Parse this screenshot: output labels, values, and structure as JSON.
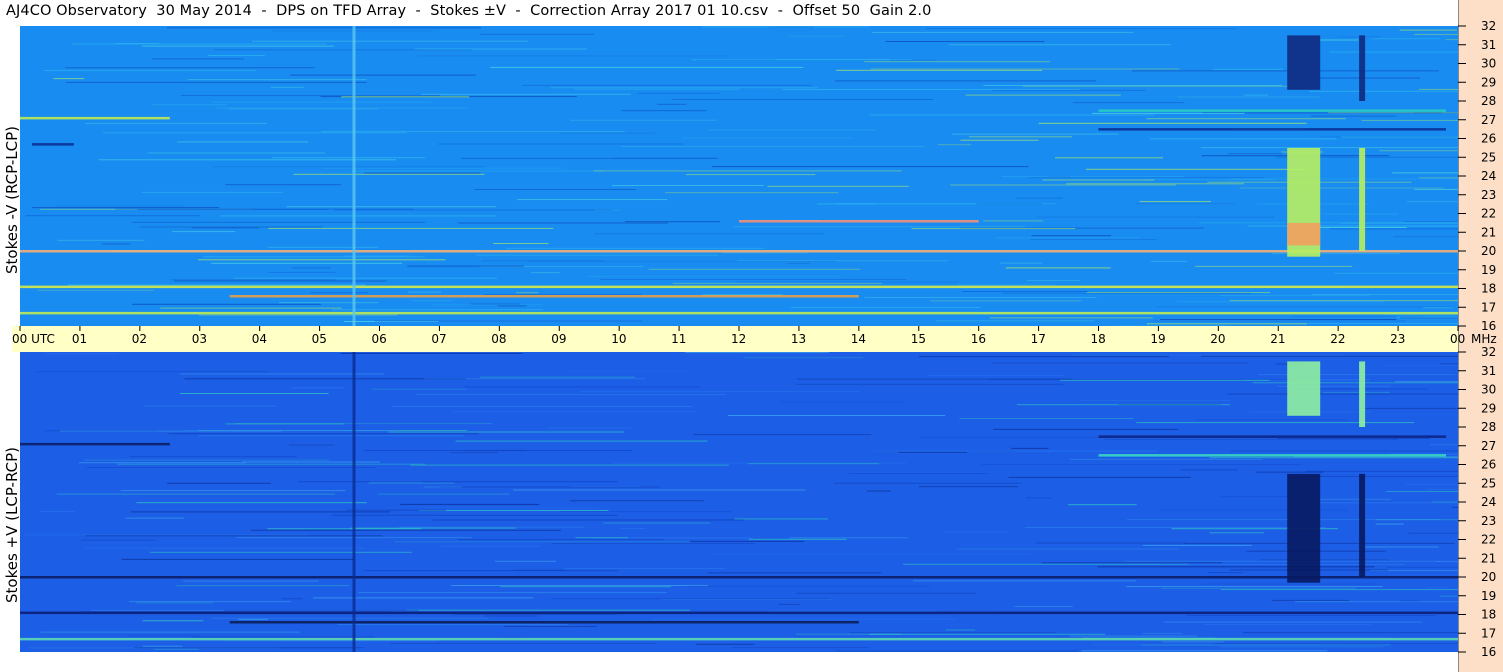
{
  "title": "AJ4CO Observatory  30 May 2014  -  DPS on TFD Array  -  Stokes ±V  -  Correction Array 2017 01 10.csv  -  Offset 50  Gain 2.0",
  "colors": {
    "top_background": "#188cf0",
    "bottom_background": "#1c5ee6",
    "timebar": "#ffffc6",
    "freq_strip": "#fcdfc6"
  },
  "chart_data": [
    {
      "type": "heatmap",
      "ylabel": "Stokes -V (RCP-LCP)",
      "y_unit": "MHz",
      "ylim": [
        16,
        32
      ],
      "y_ticks": [
        "16",
        "17",
        "18",
        "19",
        "20",
        "21",
        "22",
        "23",
        "24",
        "25",
        "26",
        "27",
        "28",
        "29",
        "30",
        "31",
        "32"
      ],
      "x_ticks": [
        "00 UTC",
        "01",
        "02",
        "03",
        "04",
        "05",
        "06",
        "07",
        "08",
        "09",
        "10",
        "11",
        "12",
        "13",
        "14",
        "15",
        "16",
        "17",
        "18",
        "19",
        "20",
        "21",
        "22",
        "23",
        "00"
      ],
      "xlim_hours": [
        0,
        24
      ],
      "features": [
        {
          "kind": "band",
          "freq": 27.1,
          "t_start": 0.0,
          "t_end": 2.5,
          "color": "#c8f04a"
        },
        {
          "kind": "band",
          "freq": 20.0,
          "t_start": 0.0,
          "t_end": 24.0,
          "color": "#ffb070"
        },
        {
          "kind": "band",
          "freq": 18.1,
          "t_start": 0.0,
          "t_end": 24.0,
          "color": "#e0f040"
        },
        {
          "kind": "band",
          "freq": 17.6,
          "t_start": 3.5,
          "t_end": 14.0,
          "color": "#f0a040"
        },
        {
          "kind": "band",
          "freq": 21.6,
          "t_start": 12.0,
          "t_end": 16.0,
          "color": "#ff9070"
        },
        {
          "kind": "band",
          "freq": 16.7,
          "t_start": 0.0,
          "t_end": 24.0,
          "color": "#c8f04a"
        },
        {
          "kind": "band",
          "freq": 26.5,
          "t_start": 18.0,
          "t_end": 23.8,
          "color": "#0a2a90"
        },
        {
          "kind": "band",
          "freq": 27.5,
          "t_start": 18.0,
          "t_end": 23.8,
          "color": "#2acfc0"
        },
        {
          "kind": "band",
          "freq": 25.7,
          "t_start": 0.2,
          "t_end": 0.9,
          "color": "#0a2a90"
        },
        {
          "kind": "vline",
          "t": 5.55,
          "f_start": 16.0,
          "f_end": 32.0,
          "color": "#5cc8f0"
        },
        {
          "kind": "block",
          "t_start": 21.15,
          "t_end": 21.7,
          "f_start": 28.6,
          "f_end": 31.5,
          "color": "#102a80"
        },
        {
          "kind": "block",
          "t_start": 21.15,
          "t_end": 21.7,
          "f_start": 19.7,
          "f_end": 25.5,
          "color": "#b8f060"
        },
        {
          "kind": "block",
          "t_start": 21.15,
          "t_end": 21.7,
          "f_start": 20.3,
          "f_end": 21.5,
          "color": "#f0a060"
        },
        {
          "kind": "block",
          "t_start": 22.35,
          "t_end": 22.45,
          "f_start": 28.0,
          "f_end": 31.5,
          "color": "#102a80"
        },
        {
          "kind": "block",
          "t_start": 22.35,
          "t_end": 22.45,
          "f_start": 20.0,
          "f_end": 25.5,
          "color": "#b8f060"
        }
      ]
    },
    {
      "type": "heatmap",
      "ylabel": "Stokes +V (LCP-RCP)",
      "y_unit": "MHz",
      "ylim": [
        16,
        32
      ],
      "y_ticks": [
        "16",
        "17",
        "18",
        "19",
        "20",
        "21",
        "22",
        "23",
        "24",
        "25",
        "26",
        "27",
        "28",
        "29",
        "30",
        "31",
        "32"
      ],
      "x_ticks": [
        "00 UTC",
        "01",
        "02",
        "03",
        "04",
        "05",
        "06",
        "07",
        "08",
        "09",
        "10",
        "11",
        "12",
        "13",
        "14",
        "15",
        "16",
        "17",
        "18",
        "19",
        "20",
        "21",
        "22",
        "23",
        "00"
      ],
      "xlim_hours": [
        0,
        24
      ],
      "features": [
        {
          "kind": "band",
          "freq": 27.1,
          "t_start": 0.0,
          "t_end": 2.5,
          "color": "#0a1a60"
        },
        {
          "kind": "band",
          "freq": 20.0,
          "t_start": 0.0,
          "t_end": 24.0,
          "color": "#0a1a60"
        },
        {
          "kind": "band",
          "freq": 18.1,
          "t_start": 0.0,
          "t_end": 24.0,
          "color": "#0a1a70"
        },
        {
          "kind": "band",
          "freq": 17.6,
          "t_start": 3.5,
          "t_end": 14.0,
          "color": "#0a1a50"
        },
        {
          "kind": "band",
          "freq": 16.7,
          "t_start": 0.0,
          "t_end": 24.0,
          "color": "#60e0b0"
        },
        {
          "kind": "band",
          "freq": 26.5,
          "t_start": 18.0,
          "t_end": 23.8,
          "color": "#3adfc0"
        },
        {
          "kind": "band",
          "freq": 27.5,
          "t_start": 18.0,
          "t_end": 23.8,
          "color": "#0a2080"
        },
        {
          "kind": "vline",
          "t": 5.55,
          "f_start": 16.0,
          "f_end": 32.0,
          "color": "#0a2a90"
        },
        {
          "kind": "block",
          "t_start": 21.15,
          "t_end": 21.7,
          "f_start": 28.6,
          "f_end": 31.5,
          "color": "#90f0a0"
        },
        {
          "kind": "block",
          "t_start": 21.15,
          "t_end": 21.7,
          "f_start": 19.7,
          "f_end": 25.5,
          "color": "#081a60"
        },
        {
          "kind": "block",
          "t_start": 22.35,
          "t_end": 22.45,
          "f_start": 28.0,
          "f_end": 31.5,
          "color": "#90f0a0"
        },
        {
          "kind": "block",
          "t_start": 22.35,
          "t_end": 22.45,
          "f_start": 20.0,
          "f_end": 25.5,
          "color": "#081a60"
        }
      ]
    }
  ]
}
